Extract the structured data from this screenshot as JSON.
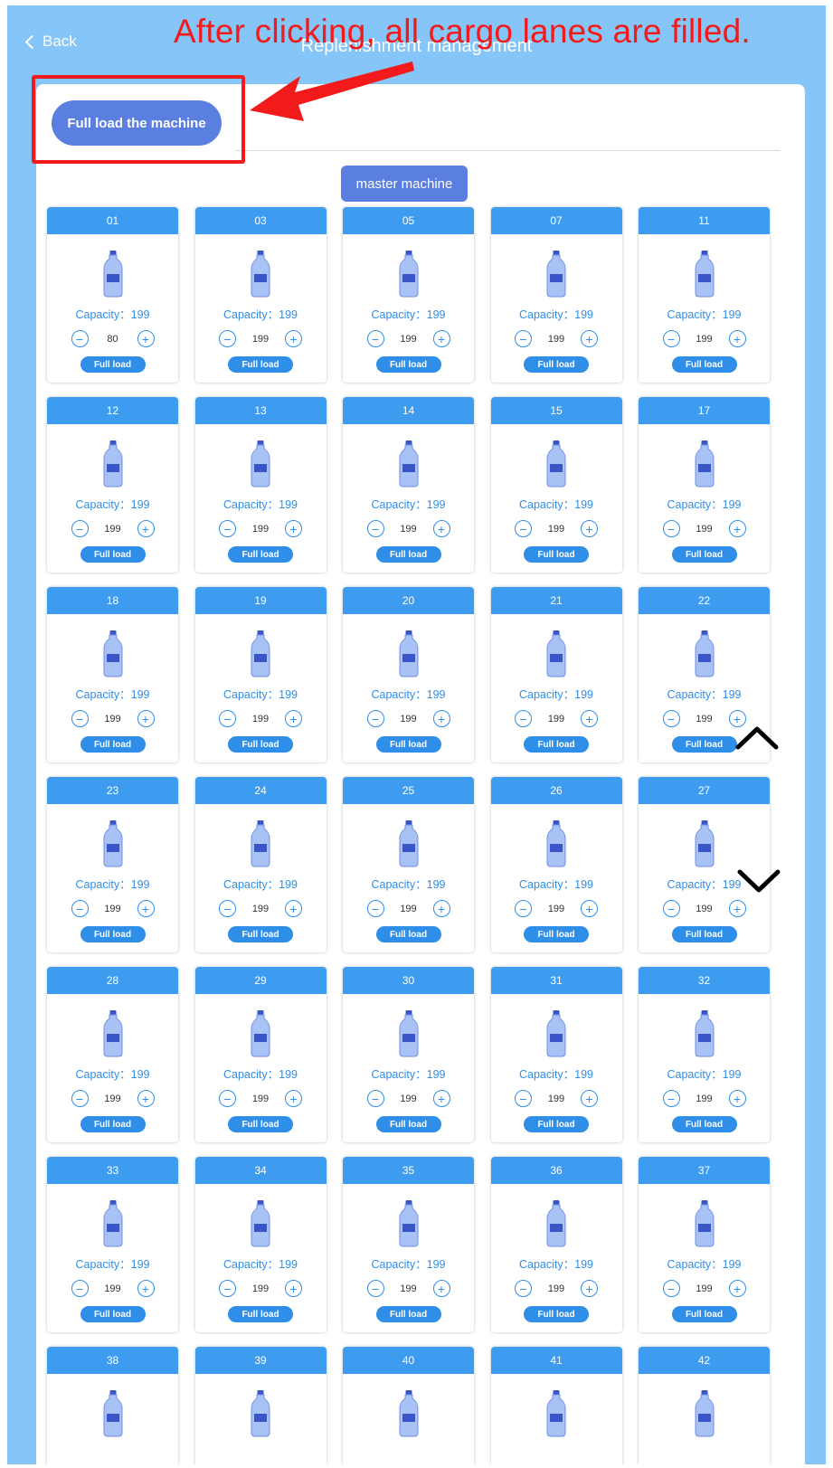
{
  "header": {
    "back_label": "Back",
    "title": "Replenishment management"
  },
  "actions": {
    "full_load_machine_label": "Full load the machine",
    "machine_tab_label": "master machine"
  },
  "annotation": {
    "text": "After clicking, all cargo lanes are filled."
  },
  "lane_labels": {
    "capacity_prefix": "Capacity：",
    "full_load": "Full load"
  },
  "lanes": [
    {
      "id": "01",
      "capacity": "199",
      "qty": "80"
    },
    {
      "id": "03",
      "capacity": "199",
      "qty": "199"
    },
    {
      "id": "05",
      "capacity": "199",
      "qty": "199"
    },
    {
      "id": "07",
      "capacity": "199",
      "qty": "199"
    },
    {
      "id": "11",
      "capacity": "199",
      "qty": "199"
    },
    {
      "id": "12",
      "capacity": "199",
      "qty": "199"
    },
    {
      "id": "13",
      "capacity": "199",
      "qty": "199"
    },
    {
      "id": "14",
      "capacity": "199",
      "qty": "199"
    },
    {
      "id": "15",
      "capacity": "199",
      "qty": "199"
    },
    {
      "id": "17",
      "capacity": "199",
      "qty": "199"
    },
    {
      "id": "18",
      "capacity": "199",
      "qty": "199"
    },
    {
      "id": "19",
      "capacity": "199",
      "qty": "199"
    },
    {
      "id": "20",
      "capacity": "199",
      "qty": "199"
    },
    {
      "id": "21",
      "capacity": "199",
      "qty": "199"
    },
    {
      "id": "22",
      "capacity": "199",
      "qty": "199"
    },
    {
      "id": "23",
      "capacity": "199",
      "qty": "199"
    },
    {
      "id": "24",
      "capacity": "199",
      "qty": "199"
    },
    {
      "id": "25",
      "capacity": "199",
      "qty": "199"
    },
    {
      "id": "26",
      "capacity": "199",
      "qty": "199"
    },
    {
      "id": "27",
      "capacity": "199",
      "qty": "199"
    },
    {
      "id": "28",
      "capacity": "199",
      "qty": "199"
    },
    {
      "id": "29",
      "capacity": "199",
      "qty": "199"
    },
    {
      "id": "30",
      "capacity": "199",
      "qty": "199"
    },
    {
      "id": "31",
      "capacity": "199",
      "qty": "199"
    },
    {
      "id": "32",
      "capacity": "199",
      "qty": "199"
    },
    {
      "id": "33",
      "capacity": "199",
      "qty": "199"
    },
    {
      "id": "34",
      "capacity": "199",
      "qty": "199"
    },
    {
      "id": "35",
      "capacity": "199",
      "qty": "199"
    },
    {
      "id": "36",
      "capacity": "199",
      "qty": "199"
    },
    {
      "id": "37",
      "capacity": "199",
      "qty": "199"
    },
    {
      "id": "38"
    },
    {
      "id": "39"
    },
    {
      "id": "40"
    },
    {
      "id": "41"
    },
    {
      "id": "42"
    }
  ],
  "icons": {
    "back": "chevron-left-icon",
    "bottle": "water-bottle-icon",
    "minus": "minus-circle-icon",
    "plus": "plus-circle-icon",
    "scroll_up": "chevron-up-icon",
    "scroll_down": "chevron-down-icon",
    "arrow": "red-arrow-icon"
  },
  "colors": {
    "background": "#86c5f7",
    "lane_header": "#3d9cf0",
    "primary_button": "#5a7fe0",
    "accent_text": "#2f8ee8",
    "annotation": "#f21a1a"
  }
}
